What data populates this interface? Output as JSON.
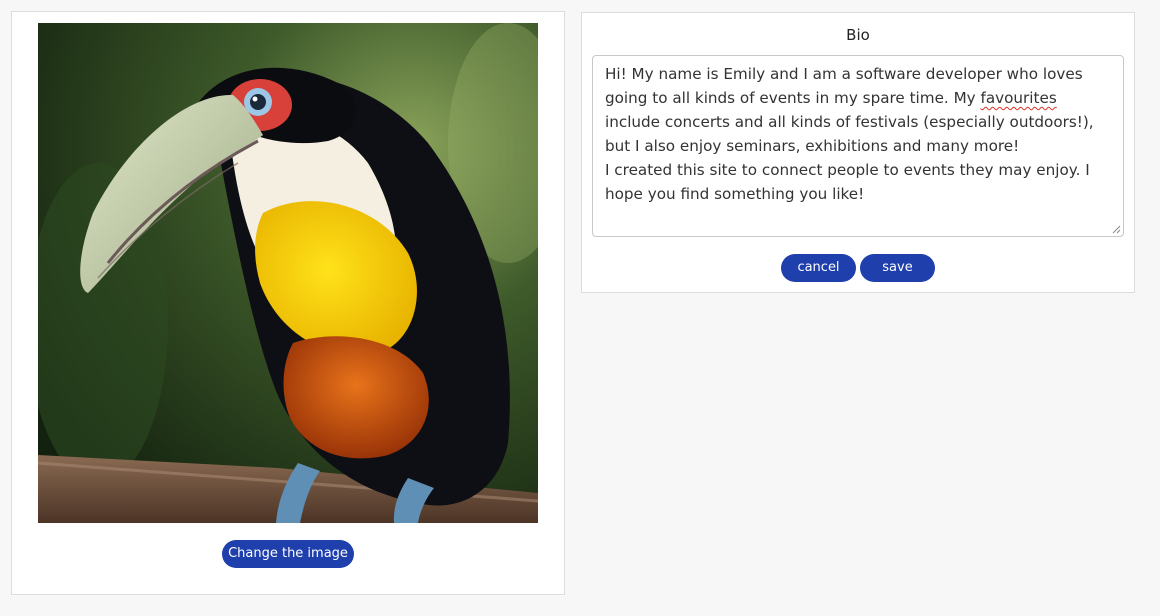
{
  "photo_card": {
    "image_alt": "Toucan perched on a branch",
    "change_label": "Change the image"
  },
  "bio_card": {
    "title": "Bio",
    "text_before": "Hi! My name is Emily and I am a software developer who loves going to all kinds of events in my spare time. My ",
    "misspelled": "favourites",
    "text_after": " include concerts and all kinds of festivals (especially outdoors!), but I also enjoy seminars, exhibitions and many more!\nI created this site to connect people to events they may enjoy. I hope you find something you like!",
    "cancel_label": "cancel",
    "save_label": "save"
  },
  "colors": {
    "accent": "#1f3fad",
    "page_bg": "#f7f7f7",
    "card_bg": "#ffffff",
    "spellcheck": "#d93025"
  },
  "icons": {
    "resize": "resize-grip-icon"
  }
}
